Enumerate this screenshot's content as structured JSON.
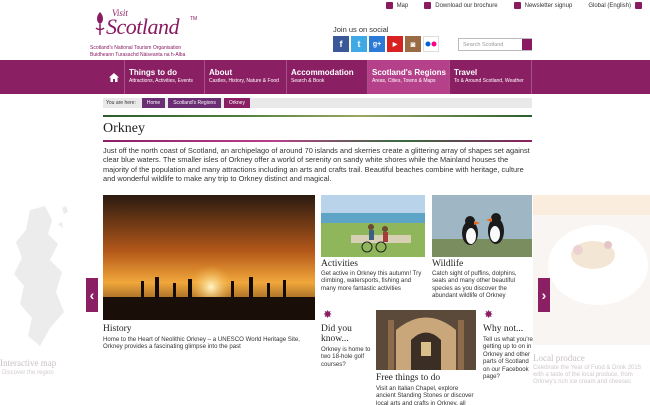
{
  "header": {
    "logo_visit": "Visit",
    "logo_scotland": "Scotland",
    "logo_tm": "TM",
    "tagline_1": "Scotland's National Tourism Organisation",
    "tagline_2": "Buidheann Turasachd Nàiseanta na h-Alba",
    "links": {
      "map": "Map",
      "brochure": "Download our brochure",
      "newsletter": "Newsletter signup",
      "language": "Global (English)"
    },
    "social_title": "Join us on social",
    "social": [
      {
        "name": "facebook-icon",
        "glyph": "f",
        "color": "#3b5998"
      },
      {
        "name": "twitter-icon",
        "glyph": "t",
        "color": "#3fa9e6"
      },
      {
        "name": "google-plus-icon",
        "glyph": "g+",
        "color": "#2d7ad6"
      },
      {
        "name": "youtube-icon",
        "glyph": "▶",
        "color": "#d82222"
      },
      {
        "name": "instagram-icon",
        "glyph": "◙",
        "color": "#9b6c44"
      },
      {
        "name": "flickr-icon",
        "glyph": "••",
        "color": "#ffffff"
      }
    ],
    "search_placeholder": "Search Scotland"
  },
  "nav": {
    "items": [
      {
        "title": "Things to do",
        "sub": "Attractions, Activities, Events"
      },
      {
        "title": "About",
        "sub": "Castles, History, Nature & Food"
      },
      {
        "title": "Accommodation",
        "sub": "Search & Book"
      },
      {
        "title": "Scotland's Regions",
        "sub": "Areas, Cities, Towns & Maps"
      },
      {
        "title": "Travel",
        "sub": "To & Around Scotland, Weather"
      }
    ]
  },
  "breadcrumb": {
    "label": "You are here:",
    "items": [
      "Home",
      "Scotland's Regions",
      "Orkney"
    ]
  },
  "page": {
    "title": "Orkney",
    "intro": "Just off the north coast of Scotland, an archipelago of around 70 islands and skerries create a glittering array of shapes set against clear blue waters. The smaller isles of Orkney offer a world of serenity on sandy white shores while the Mainland houses the majority of the population and many attractions including an arts and crafts trail. Beautiful beaches combine with heritage, culture and wonderful wildlife to make any trip to Orkney distinct and magical."
  },
  "side": {
    "map_label": "Interactive map",
    "map_sub": "Discover the region",
    "local_label": "Local produce",
    "local_sub": "Celebrate the Year of Food & Drink 2015 with a taste of the local produce, from Orkney's rich ice cream and cheeses"
  },
  "tiles": {
    "history": {
      "title": "History",
      "text": "Home to the Heart of Neolithic Orkney – a UNESCO World Heritage Site, Orkney provides a fascinating glimpse into the past"
    },
    "activities": {
      "title": "Activities",
      "text": "Get active in Orkney this autumn! Try climbing, watersports, fishing and many more fantastic activities"
    },
    "wildlife": {
      "title": "Wildlife",
      "text": "Catch sight of puffins, dolphins, seals and many other beautiful species as you discover the abundant wildlife of Orkney"
    },
    "did_you_know": {
      "title": "Did you know...",
      "text": "Orkney is home to two 18-hole golf courses?"
    },
    "free": {
      "title": "Free things to do",
      "text": "Visit an Italian Chapel, explore ancient Standing Stones or discover local arts and crafts in Orkney, all absolutely free"
    },
    "why_not": {
      "title": "Why not...",
      "text": "Tell us what you're getting up to on in Orkney and other parts of Scotland on our Facebook page?"
    }
  },
  "colors": {
    "brand": "#8b1f64",
    "nav_active": "#b6418b",
    "breadcrumb": "#6b2d74"
  }
}
